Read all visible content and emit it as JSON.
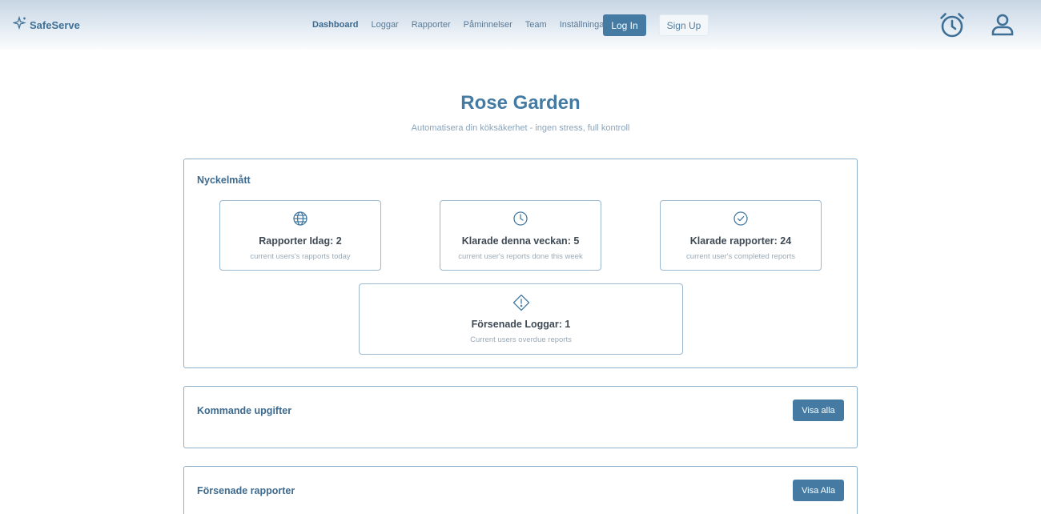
{
  "brand": {
    "name": "SafeServe",
    "icon": "sparkle-icon"
  },
  "nav": {
    "links": [
      "Dashboard",
      "Loggar",
      "Rapporter",
      "Påminnelser",
      "Team",
      "Inställningar"
    ],
    "active_index": 0,
    "login_label": "Log In",
    "signup_label": "Sign Up",
    "icons": [
      "alarm-clock-icon",
      "user-icon"
    ]
  },
  "page": {
    "title": "Rose Garden",
    "subtitle": "Automatisera din köksäkerhet - ingen stress, full kontroll"
  },
  "metrics": {
    "title": "Nyckelmått",
    "cards": [
      {
        "icon": "globe-icon",
        "title": "Rapporter Idag: 2",
        "subtitle": "current users's rapports today"
      },
      {
        "icon": "clock-icon",
        "title": "Klarade denna veckan: 5",
        "subtitle": "current user's reports done this week"
      },
      {
        "icon": "check-circle-icon",
        "title": "Klarade rapporter: 24",
        "subtitle": "current user's completed reports"
      },
      {
        "icon": "warning-diamond-icon",
        "title": "Försenade Loggar: 1",
        "subtitle": "Current users overdue reports"
      }
    ]
  },
  "upcoming": {
    "title": "Kommande upgifter",
    "button_label": "Visa alla"
  },
  "overdue": {
    "title": "Försenade rapporter",
    "button_label": "Visa Alla"
  },
  "colors": {
    "accent": "#457ba3",
    "border": "#8fb0cb",
    "heading": "#3d6a8f"
  }
}
